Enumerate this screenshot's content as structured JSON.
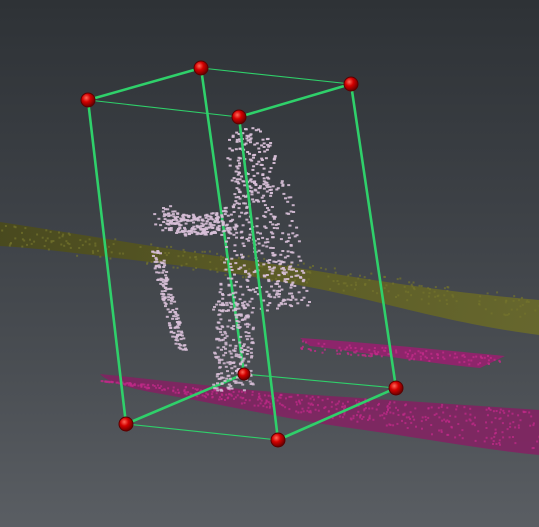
{
  "viewer": {
    "background_top": "#2e3236",
    "background_bottom": "#5a5e63"
  },
  "bounding_box": {
    "color": "#2fd06a",
    "handle_color": "#d40000",
    "handle_icon": "sphere-handle-icon",
    "corner_count": 8,
    "interaction": "draggable-corner-handles"
  },
  "point_clouds": [
    {
      "label": "person",
      "color": "#d8c0d8"
    },
    {
      "label": "ground-strip-olive",
      "color": "#5a5a22"
    },
    {
      "label": "ground-strip-magenta",
      "color": "#b0207a"
    }
  ]
}
